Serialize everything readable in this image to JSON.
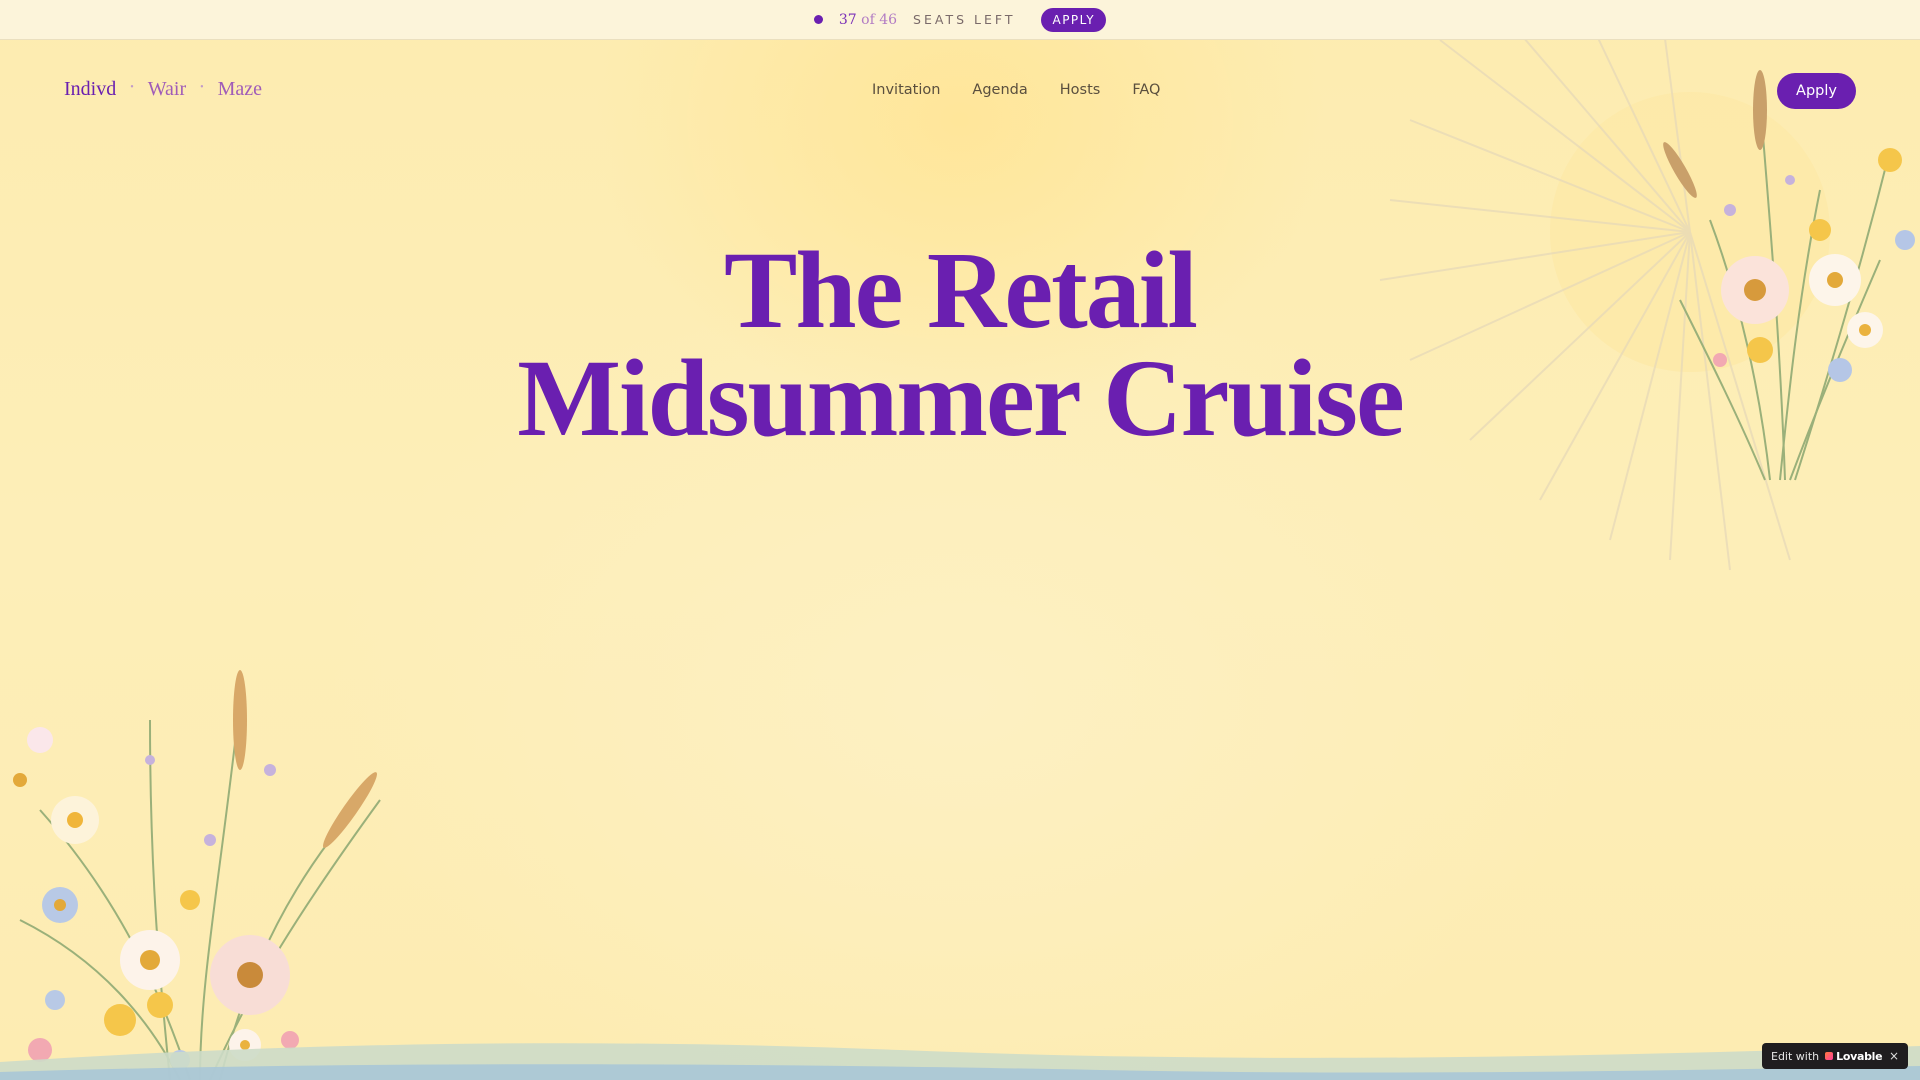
{
  "seats_bar": {
    "count": "37",
    "of_total": "of 46",
    "label": "SEATS LEFT",
    "apply_label": "APPLY"
  },
  "header": {
    "brand": [
      "Indivd",
      "Wair",
      "Maze"
    ],
    "nav": [
      "Invitation",
      "Agenda",
      "Hosts",
      "FAQ"
    ],
    "apply_label": "Apply"
  },
  "hero": {
    "title_line1": "The Retail",
    "title_line2": "Midsummer Cruise"
  },
  "badge": {
    "edit_label": "Edit with",
    "brand": "Lovable",
    "close_icon": "×"
  },
  "colors": {
    "accent": "#6a1fb0",
    "background": "#fdeeb4",
    "nav_text": "#5a4f3e"
  },
  "icons": [
    "status-dot-icon",
    "close-icon",
    "lovable-heart-icon",
    "sun-illustration",
    "flower-bouquet-illustration",
    "water-wave-illustration"
  ]
}
